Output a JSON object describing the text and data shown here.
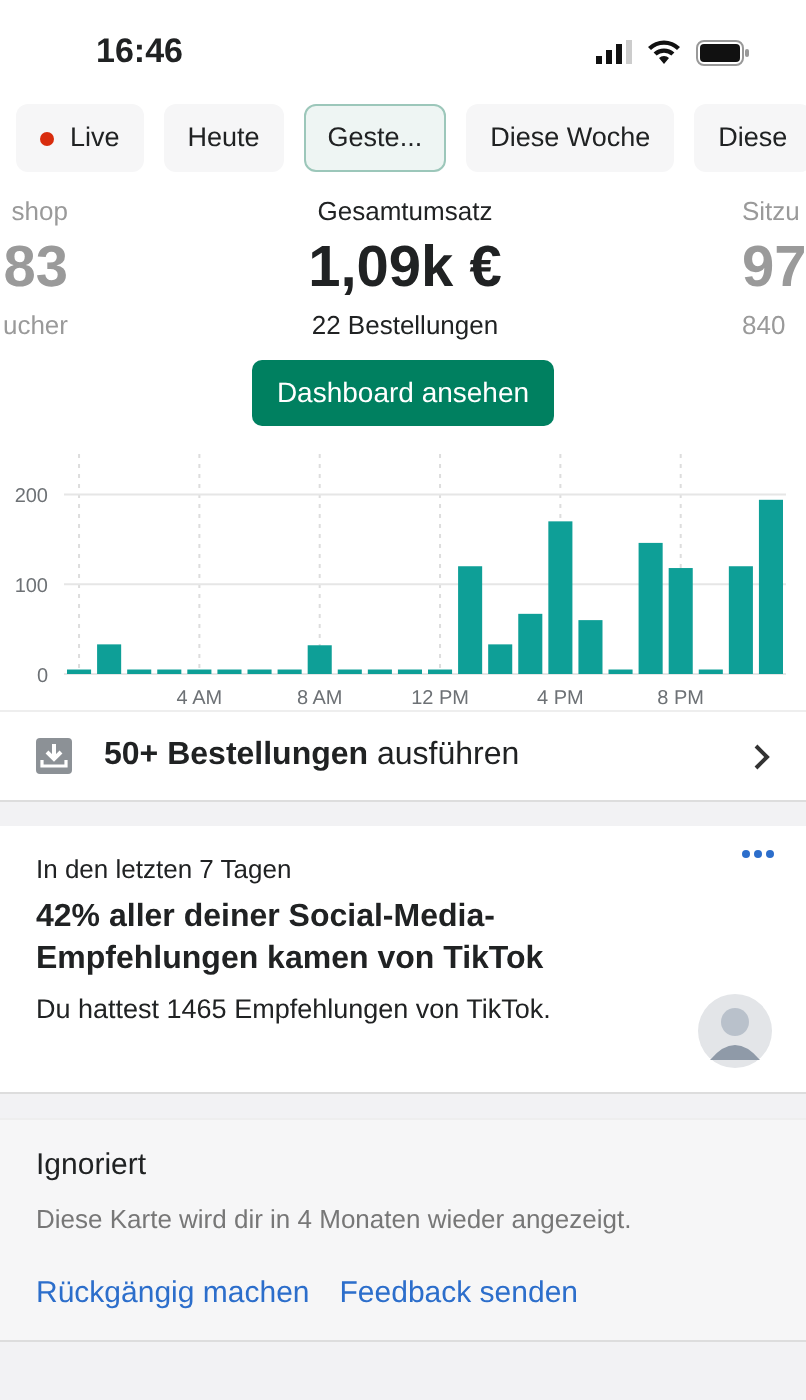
{
  "status_bar": {
    "time": "16:46"
  },
  "tabs": [
    {
      "label": "Live",
      "kind": "live",
      "selected": false
    },
    {
      "label": "Heute",
      "kind": "period",
      "selected": false
    },
    {
      "label": "Geste...",
      "kind": "period",
      "selected": true
    },
    {
      "label": "Diese Woche",
      "kind": "period",
      "selected": false
    },
    {
      "label": "Diese",
      "kind": "period",
      "selected": false
    }
  ],
  "metrics": [
    {
      "label": "shop",
      "value": "83",
      "sub": "ucher",
      "selected": false
    },
    {
      "label": "Gesamtumsatz",
      "value": "1,09k €",
      "sub": "22 Bestellungen",
      "selected": true
    },
    {
      "label": "Sitzu",
      "value": "97",
      "sub": "840",
      "selected": false
    }
  ],
  "dashboard_button": "Dashboard ansehen",
  "chart": {
    "chart_data": {
      "type": "bar",
      "categories": [
        null,
        null,
        null,
        null,
        "4 AM",
        null,
        null,
        null,
        "8 AM",
        null,
        null,
        null,
        "12 PM",
        null,
        null,
        null,
        "4 PM",
        null,
        null,
        null,
        "8 PM",
        null,
        null,
        null
      ],
      "series": [
        {
          "color": "#0e9f97",
          "values": [
            5,
            33,
            5,
            5,
            5,
            5,
            5,
            5,
            32,
            5,
            5,
            5,
            5,
            120,
            33,
            67,
            170,
            60,
            5,
            146,
            118,
            5,
            120,
            194
          ]
        }
      ],
      "grid": true,
      "ylim": [
        0,
        245
      ],
      "yticks": [
        {
          "value": 0,
          "label": "0"
        },
        {
          "value": 100,
          "label": "100"
        },
        {
          "value": 200,
          "label": "200"
        }
      ]
    }
  },
  "task_row": {
    "text": "**50+ Bestellungen** ausführen"
  },
  "insight_card": {
    "eyebrow": "In den letzten 7 Tagen",
    "title": "42% aller deiner Social-Media-Empfehlungen kamen von TikTok",
    "body": "Du hattest 1465 Empfehlungen von TikTok."
  },
  "ignored_card": {
    "title": "Ignoriert",
    "body": "Diese Karte wird dir in 4 Monaten wieder angezeigt.",
    "links": [
      "Rückgängig machen",
      "Feedback senden"
    ]
  }
}
